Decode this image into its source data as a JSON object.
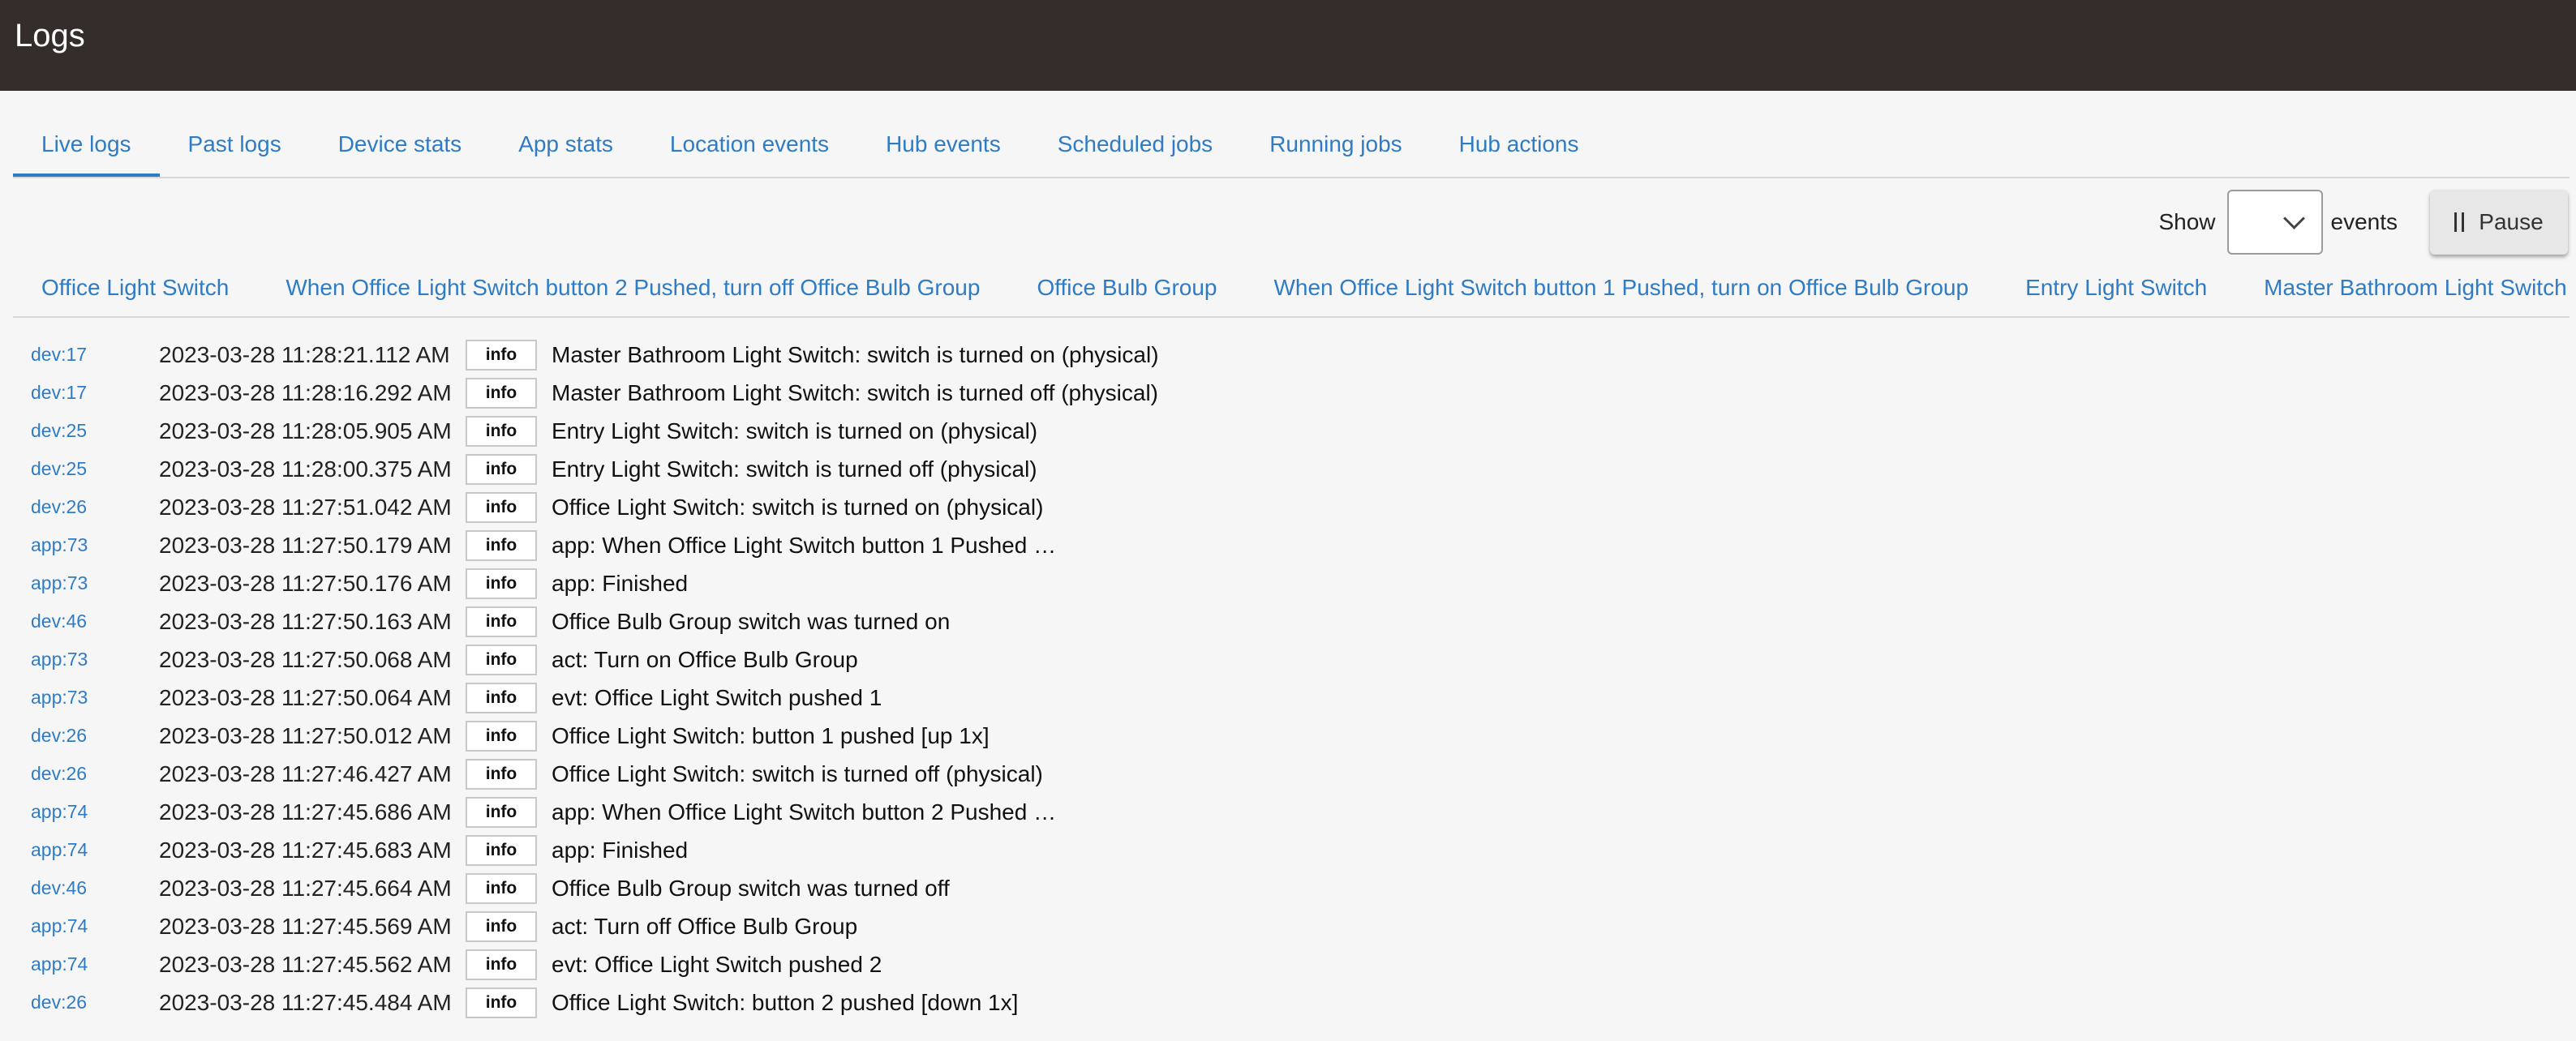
{
  "header": {
    "title": "Logs"
  },
  "tabs": [
    {
      "label": "Live logs",
      "active": true
    },
    {
      "label": "Past logs"
    },
    {
      "label": "Device stats"
    },
    {
      "label": "App stats"
    },
    {
      "label": "Location events"
    },
    {
      "label": "Hub events"
    },
    {
      "label": "Scheduled jobs"
    },
    {
      "label": "Running jobs"
    },
    {
      "label": "Hub actions"
    }
  ],
  "toolbar": {
    "show_label": "Show",
    "events_select_value": "",
    "events_label": "events",
    "pause_label": "Pause"
  },
  "filters": [
    "Office Light Switch",
    "When Office Light Switch button 2 Pushed, turn off Office Bulb Group",
    "Office Bulb Group",
    "When Office Light Switch button 1 Pushed, turn on Office Bulb Group",
    "Entry Light Switch",
    "Master Bathroom Light Switch"
  ],
  "logs": [
    {
      "src": "dev:17",
      "time": "2023-03-28 11:28:21.112 AM",
      "level": "info",
      "msg": "Master Bathroom Light Switch: switch is turned on (physical)"
    },
    {
      "src": "dev:17",
      "time": "2023-03-28 11:28:16.292 AM",
      "level": "info",
      "msg": "Master Bathroom Light Switch: switch is turned off (physical)"
    },
    {
      "src": "dev:25",
      "time": "2023-03-28 11:28:05.905 AM",
      "level": "info",
      "msg": "Entry Light Switch: switch is turned on (physical)"
    },
    {
      "src": "dev:25",
      "time": "2023-03-28 11:28:00.375 AM",
      "level": "info",
      "msg": "Entry Light Switch: switch is turned off (physical)"
    },
    {
      "src": "dev:26",
      "time": "2023-03-28 11:27:51.042 AM",
      "level": "info",
      "msg": "Office Light Switch: switch is turned on (physical)"
    },
    {
      "src": "app:73",
      "time": "2023-03-28 11:27:50.179 AM",
      "level": "info",
      "msg": "app: When Office Light Switch button 1 Pushed …"
    },
    {
      "src": "app:73",
      "time": "2023-03-28 11:27:50.176 AM",
      "level": "info",
      "msg": "app: Finished"
    },
    {
      "src": "dev:46",
      "time": "2023-03-28 11:27:50.163 AM",
      "level": "info",
      "msg": "Office Bulb Group switch was turned on"
    },
    {
      "src": "app:73",
      "time": "2023-03-28 11:27:50.068 AM",
      "level": "info",
      "msg": "act: Turn on Office Bulb Group"
    },
    {
      "src": "app:73",
      "time": "2023-03-28 11:27:50.064 AM",
      "level": "info",
      "msg": "evt: Office Light Switch pushed 1"
    },
    {
      "src": "dev:26",
      "time": "2023-03-28 11:27:50.012 AM",
      "level": "info",
      "msg": "Office Light Switch: button 1 pushed [up 1x]"
    },
    {
      "src": "dev:26",
      "time": "2023-03-28 11:27:46.427 AM",
      "level": "info",
      "msg": "Office Light Switch: switch is turned off (physical)"
    },
    {
      "src": "app:74",
      "time": "2023-03-28 11:27:45.686 AM",
      "level": "info",
      "msg": "app: When Office Light Switch button 2 Pushed …"
    },
    {
      "src": "app:74",
      "time": "2023-03-28 11:27:45.683 AM",
      "level": "info",
      "msg": "app: Finished"
    },
    {
      "src": "dev:46",
      "time": "2023-03-28 11:27:45.664 AM",
      "level": "info",
      "msg": "Office Bulb Group switch was turned off"
    },
    {
      "src": "app:74",
      "time": "2023-03-28 11:27:45.569 AM",
      "level": "info",
      "msg": "act: Turn off Office Bulb Group"
    },
    {
      "src": "app:74",
      "time": "2023-03-28 11:27:45.562 AM",
      "level": "info",
      "msg": "evt: Office Light Switch pushed 2"
    },
    {
      "src": "dev:26",
      "time": "2023-03-28 11:27:45.484 AM",
      "level": "info",
      "msg": "Office Light Switch: button 2 pushed [down 1x]"
    }
  ]
}
